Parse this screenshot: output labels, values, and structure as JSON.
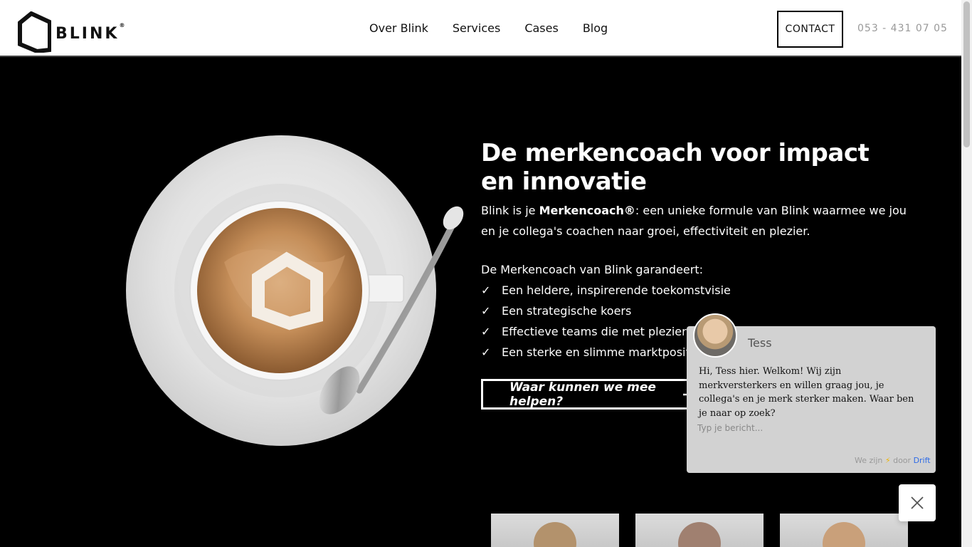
{
  "header": {
    "logo_text": "BLINK",
    "logo_mark": "®",
    "nav": [
      "Over Blink",
      "Services",
      "Cases",
      "Blog"
    ],
    "contact_label": "CONTACT",
    "phone": "053 - 431 07 05"
  },
  "hero": {
    "title": "De merkencoach voor impact en innovatie",
    "intro_prefix": "Blink is je ",
    "intro_bold": "Merkencoach®",
    "intro_suffix": ": een unieke formule van Blink waarmee we jou en je collega's coachen naar groei, effectiviteit en plezier.",
    "guarantee_label": "De Merkencoach van Blink garandeert:",
    "check_symbol": "✓",
    "checklist": [
      "Een heldere, inspirerende toekomstvisie",
      "Een strategische koers",
      "Effectieve teams die met plezier presteren",
      "Een sterke en slimme marktpositie"
    ],
    "cta_label": "Waar kunnen we mee helpen?"
  },
  "chat": {
    "agent_name": "Tess",
    "message": "Hi, Tess hier. Welkom! Wij zijn merkversterkers en willen graag jou, je collega's en je merk sterker maken. Waar ben je naar op zoek?",
    "input_placeholder": "Typ je bericht...",
    "footer_prefix": "We zijn",
    "footer_bolt": "⚡",
    "footer_by": "door",
    "footer_brand": "Drift"
  },
  "icons": {
    "logo": "blink-logo-icon",
    "arrow": "arrow-right-icon",
    "close": "close-icon",
    "bolt": "bolt-icon"
  },
  "colors": {
    "background": "#000000",
    "header": "#ffffff",
    "chat_panel": "#d2d2d2",
    "drift_link": "#2e6be6"
  }
}
